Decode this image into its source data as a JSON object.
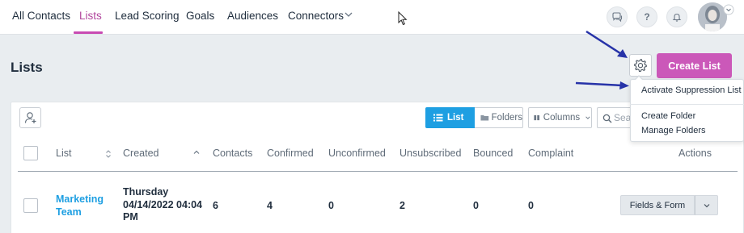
{
  "nav": {
    "items": [
      "All Contacts",
      "Lists",
      "Lead Scoring",
      "Goals",
      "Audiences",
      "Connectors"
    ],
    "active": "Lists",
    "icons": [
      "chat-icon",
      "help-icon",
      "bell-icon"
    ],
    "help_glyph": "?"
  },
  "page": {
    "title": "Lists",
    "create_label": "Create List"
  },
  "settings_menu": {
    "items": [
      "Activate Suppression List",
      "Create Folder",
      "Manage Folders"
    ]
  },
  "toolbar": {
    "list_label": "List",
    "folders_label": "Folders",
    "columns_label": "Columns",
    "search_placeholder": "Search"
  },
  "table": {
    "columns": [
      "List",
      "Created",
      "Contacts",
      "Confirmed",
      "Unconfirmed",
      "Unsubscribed",
      "Bounced",
      "Complaint",
      "Actions"
    ],
    "rows": [
      {
        "list": "Marketing Team",
        "created": "Thursday 04/14/2022 04:04 PM",
        "contacts": "6",
        "confirmed": "4",
        "unconfirmed": "0",
        "unsubscribed": "2",
        "bounced": "0",
        "complaint": "0",
        "action_label": "Fields & Form"
      }
    ]
  },
  "colors": {
    "accent": "#cb58b9",
    "nav_active": "#b1469d",
    "link": "#1e9fe2",
    "annotation_arrow": "#2733a8"
  }
}
